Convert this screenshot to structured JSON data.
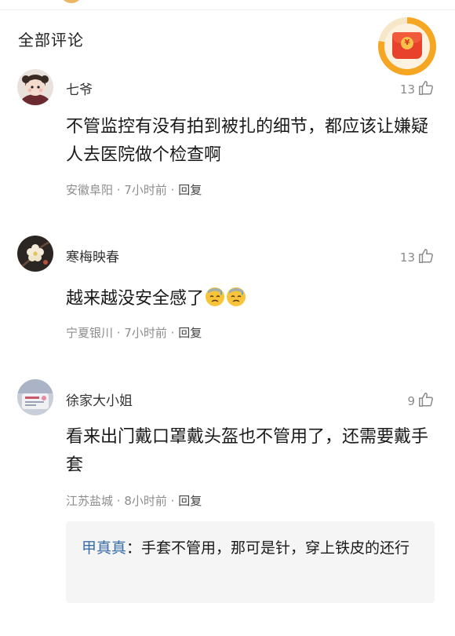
{
  "section": {
    "title": "全部评论"
  },
  "floating_widget": {
    "icon": "red-envelope-icon",
    "coin_symbol": "¥"
  },
  "comments": [
    {
      "username": "七爷",
      "likes": "13",
      "text": "不管监控有没有拍到被扎的细节，都应该让嫌疑人去医院做个检查啊",
      "location": "安徽阜阳",
      "time": "7小时前",
      "reply_label": "回复",
      "avatar": "girl-portrait-avatar"
    },
    {
      "username": "寒梅映春",
      "likes": "13",
      "text": "越来越没安全感了",
      "emojis": [
        "sweat-face-emoji",
        "sweat-face-emoji"
      ],
      "location": "宁夏银川",
      "time": "7小时前",
      "reply_label": "回复",
      "avatar": "plum-blossom-avatar"
    },
    {
      "username": "徐家大小姐",
      "likes": "9",
      "text": "看来出门戴口罩戴头盔也不管用了，还需要戴手套",
      "location": "江苏盐城",
      "time": "8小时前",
      "reply_label": "回复",
      "avatar": "photo-avatar",
      "sub_reply": {
        "author": "甲真真",
        "text": "手套不管用，那可是针，穿上铁皮的还行"
      }
    }
  ],
  "separator": " · ",
  "colors": {
    "accent_link": "#3a6ea8",
    "meta_gray": "#8d8d8d",
    "widget_ring": "#f5a623",
    "envelope_red": "#e8412c"
  }
}
